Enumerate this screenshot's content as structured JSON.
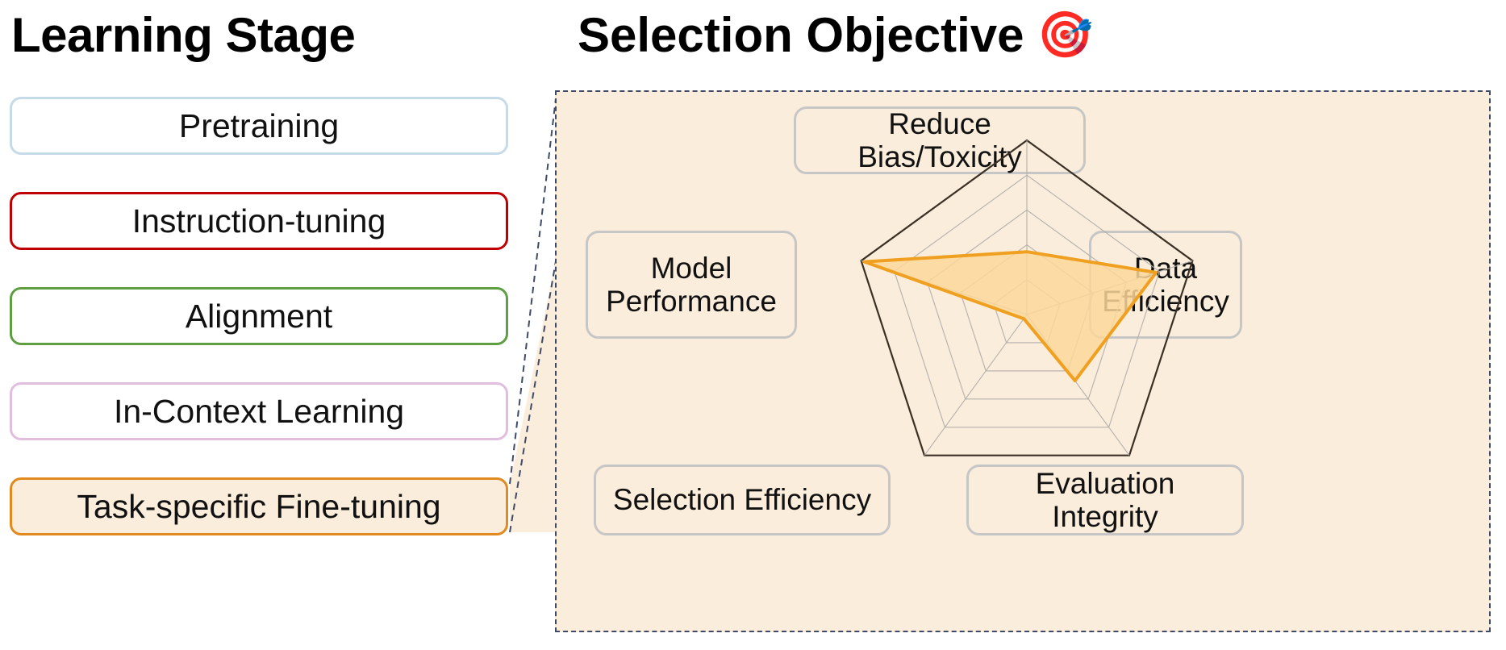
{
  "left": {
    "title": "Learning Stage",
    "stages": [
      {
        "label": "Pretraining",
        "border": "#c6dbe8",
        "fill": "#ffffff"
      },
      {
        "label": "Instruction-tuning",
        "border": "#c00000",
        "fill": "#ffffff"
      },
      {
        "label": "Alignment",
        "border": "#5f9e42",
        "fill": "#ffffff"
      },
      {
        "label": "In-Context Learning",
        "border": "#e2bede",
        "fill": "#ffffff"
      },
      {
        "label": "Task-specific Fine-tuning",
        "border": "#e08a20",
        "fill": "#fbeddc"
      }
    ]
  },
  "right": {
    "title": "Selection Objective",
    "emoji": "🎯",
    "emoji_name": "direct-hit-target-icon",
    "region_border": "#3f4a66",
    "region_fill": "#fbeddc",
    "labels": {
      "top": "Reduce Bias/Toxicity",
      "left": "Model\nPerformance",
      "left_line1": "Model",
      "left_line2": "Performance",
      "right_line1": "Data",
      "right_line2": "Efficiency",
      "bottom_left": "Selection Efficiency",
      "bottom_right": "Evaluation Integrity"
    }
  },
  "colors": {
    "accent_orange": "#f0a020",
    "polygon_fill": "#fbd79a",
    "grid_outer": "#3a3024",
    "grid_inner": "#b4b0ab",
    "label_border": "#c6c6c6",
    "panel_bg": "#fbeddc"
  },
  "chart_data": {
    "type": "radar",
    "title": "Selection Objective",
    "axes": [
      "Reduce Bias/Toxicity",
      "Data Efficiency",
      "Evaluation Integrity",
      "Selection Efficiency",
      "Model Performance"
    ],
    "series": [
      {
        "name": "Task-specific Fine-tuning",
        "values": [
          0.36,
          0.78,
          0.47,
          0.03,
          0.98
        ],
        "line_color": "#f0a020",
        "fill_color": "#fbd79a"
      }
    ],
    "rlim": [
      0,
      1
    ],
    "rings": 5,
    "grid": true,
    "legend": "none",
    "start_angle_deg": 90,
    "direction": "clockwise"
  }
}
